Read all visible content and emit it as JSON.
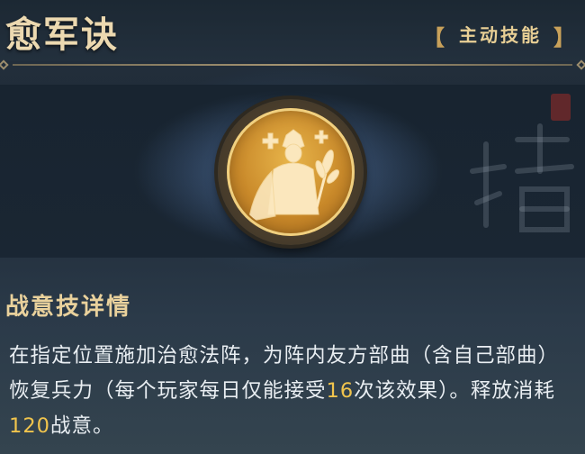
{
  "skill": {
    "title": "愈军诀",
    "tag": "主动技能",
    "tag_brackets": [
      "【",
      "】"
    ],
    "section_title": "战意技详情",
    "desc_parts": [
      "在指定位置施加治愈法阵，为阵内友方部曲（含自己部曲）恢复兵力（每个玩家每日仅能接受",
      "16",
      "次该效果）。释放消耗",
      "120",
      "战意。"
    ],
    "emblem_icon": "healing-soldier-icon"
  },
  "colors": {
    "title": "#ecd9b0",
    "highlight": "#f0c44d",
    "body_text": "#e9eef2"
  }
}
